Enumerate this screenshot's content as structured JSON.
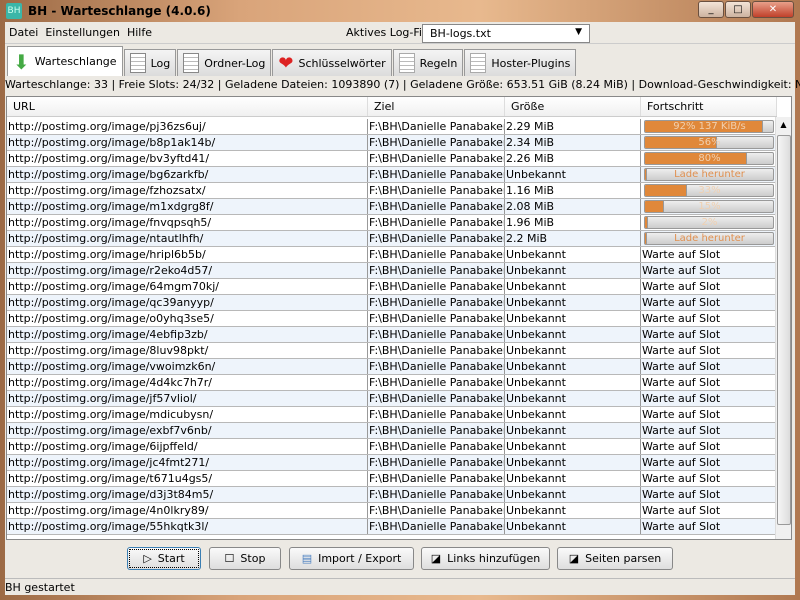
{
  "window": {
    "title": "BH - Warteschlange (4.0.6)",
    "app_icon": "BH"
  },
  "menu": [
    "Datei",
    "Einstellungen",
    "Hilfe"
  ],
  "logfile": {
    "label": "Aktives Log-File",
    "value": "BH-logs.txt"
  },
  "tabs": [
    {
      "label": "Warteschlange",
      "icon": "download-arrow-icon"
    },
    {
      "label": "Log",
      "icon": "document-icon"
    },
    {
      "label": "Ordner-Log",
      "icon": "document-icon"
    },
    {
      "label": "Schlüsselwörter",
      "icon": "heart-icon"
    },
    {
      "label": "Regeln",
      "icon": "checked-document-icon"
    },
    {
      "label": "Hoster-Plugins",
      "icon": "checked-document-icon"
    }
  ],
  "statusline": "Warteschlange: 33 | Freie Slots: 24/32 | Geladene Dateien: 1093890 (7) | Geladene Größe: 653.51 GiB (8.24 MiB) | Download-Geschwindigkeit: N/A",
  "columns": [
    "URL",
    "Ziel",
    "Größe",
    "Fortschritt"
  ],
  "ziel": "F:\\BH\\Danielle Panabaker...",
  "rows": [
    {
      "url": "http://postimg.org/image/pj36zs6uj/",
      "size": "2.29 MiB",
      "progress": 92,
      "text": "92% 137 KiB/s"
    },
    {
      "url": "http://postimg.org/image/b8p1ak14b/",
      "size": "2.34 MiB",
      "progress": 56,
      "text": "56%"
    },
    {
      "url": "http://postimg.org/image/bv3yftd41/",
      "size": "2.26 MiB",
      "progress": 80,
      "text": "80%"
    },
    {
      "url": "http://postimg.org/image/bg6zarkfb/",
      "size": "Unbekannt",
      "progress": 0,
      "text": "Lade herunter"
    },
    {
      "url": "http://postimg.org/image/fzhozsatx/",
      "size": "1.16 MiB",
      "progress": 33,
      "text": "33%"
    },
    {
      "url": "http://postimg.org/image/m1xdgrg8f/",
      "size": "2.08 MiB",
      "progress": 15,
      "text": "15%"
    },
    {
      "url": "http://postimg.org/image/fnvqpsqh5/",
      "size": "1.96 MiB",
      "progress": 2,
      "text": "2%"
    },
    {
      "url": "http://postimg.org/image/ntautlhfh/",
      "size": "2.2 MiB",
      "progress": 0,
      "text": "Lade herunter"
    },
    {
      "url": "http://postimg.org/image/hripl6b5b/",
      "size": "Unbekannt",
      "text": "Warte auf Slot"
    },
    {
      "url": "http://postimg.org/image/r2eko4d57/",
      "size": "Unbekannt",
      "text": "Warte auf Slot"
    },
    {
      "url": "http://postimg.org/image/64mgm70kj/",
      "size": "Unbekannt",
      "text": "Warte auf Slot"
    },
    {
      "url": "http://postimg.org/image/qc39anyyp/",
      "size": "Unbekannt",
      "text": "Warte auf Slot"
    },
    {
      "url": "http://postimg.org/image/o0yhq3se5/",
      "size": "Unbekannt",
      "text": "Warte auf Slot"
    },
    {
      "url": "http://postimg.org/image/4ebfip3zb/",
      "size": "Unbekannt",
      "text": "Warte auf Slot"
    },
    {
      "url": "http://postimg.org/image/8luv98pkt/",
      "size": "Unbekannt",
      "text": "Warte auf Slot"
    },
    {
      "url": "http://postimg.org/image/vwoimzk6n/",
      "size": "Unbekannt",
      "text": "Warte auf Slot"
    },
    {
      "url": "http://postimg.org/image/4d4kc7h7r/",
      "size": "Unbekannt",
      "text": "Warte auf Slot"
    },
    {
      "url": "http://postimg.org/image/jf57vliol/",
      "size": "Unbekannt",
      "text": "Warte auf Slot"
    },
    {
      "url": "http://postimg.org/image/mdicubysn/",
      "size": "Unbekannt",
      "text": "Warte auf Slot"
    },
    {
      "url": "http://postimg.org/image/exbf7v6nb/",
      "size": "Unbekannt",
      "text": "Warte auf Slot"
    },
    {
      "url": "http://postimg.org/image/6ijpffeld/",
      "size": "Unbekannt",
      "text": "Warte auf Slot"
    },
    {
      "url": "http://postimg.org/image/jc4fmt271/",
      "size": "Unbekannt",
      "text": "Warte auf Slot"
    },
    {
      "url": "http://postimg.org/image/t671u4gs5/",
      "size": "Unbekannt",
      "text": "Warte auf Slot"
    },
    {
      "url": "http://postimg.org/image/d3j3t84m5/",
      "size": "Unbekannt",
      "text": "Warte auf Slot"
    },
    {
      "url": "http://postimg.org/image/4n0lkry89/",
      "size": "Unbekannt",
      "text": "Warte auf Slot"
    },
    {
      "url": "http://postimg.org/image/55hkqtk3l/",
      "size": "Unbekannt",
      "text": "Warte auf Slot"
    }
  ],
  "buttons": {
    "start": "Start",
    "stop": "Stop",
    "import": "Import / Export",
    "links": "Links hinzufügen",
    "parse": "Seiten parsen"
  },
  "status": "BH gestartet",
  "colors": {
    "progress": "#e0883a"
  }
}
